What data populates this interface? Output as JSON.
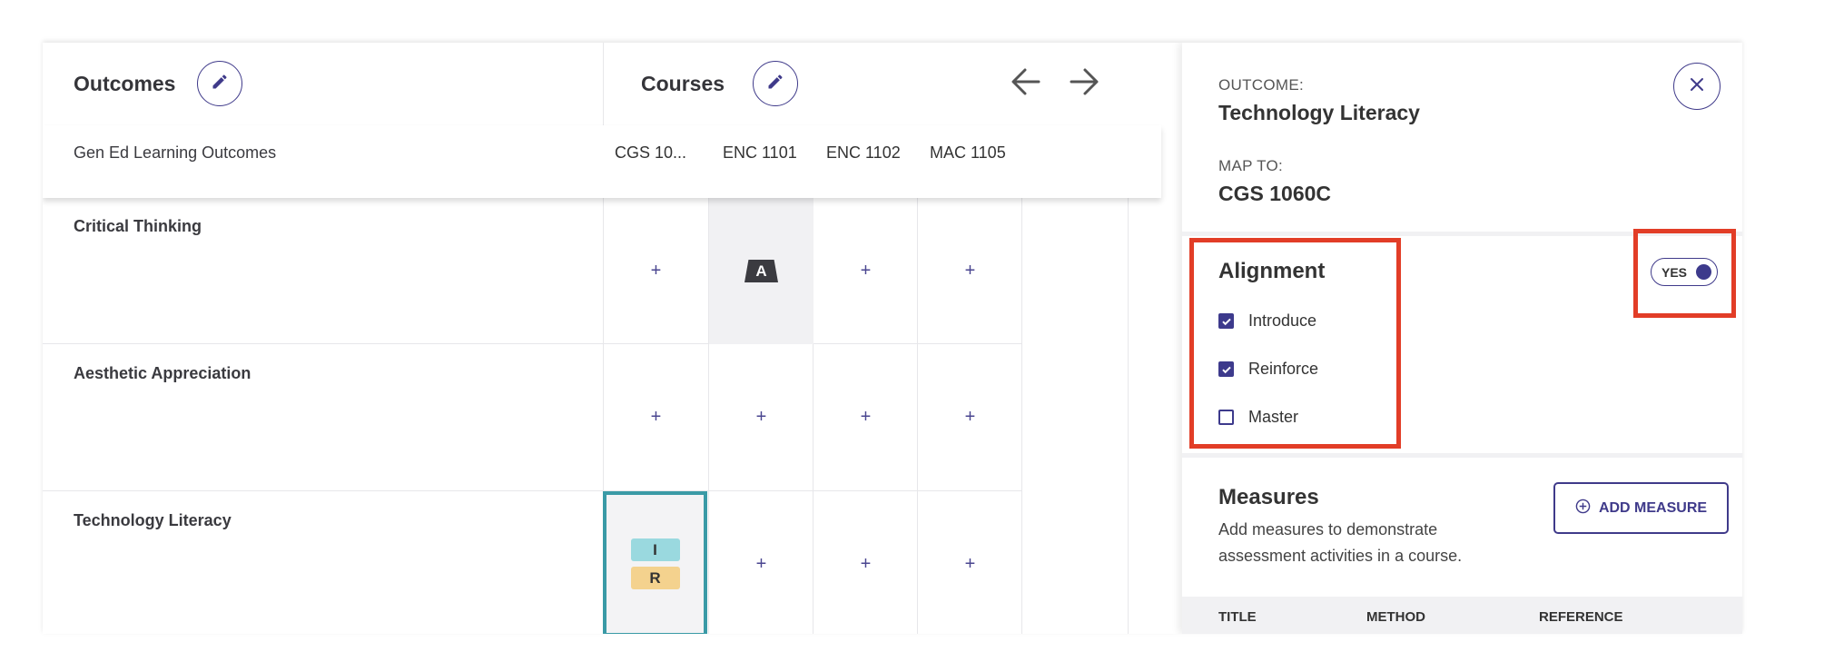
{
  "grid": {
    "outcomes_title": "Outcomes",
    "courses_title": "Courses",
    "sub_header": "Gen Ed Learning Outcomes",
    "courses": [
      "CGS 10...",
      "ENC 1101",
      "ENC 1102",
      "MAC 1105"
    ],
    "rows": [
      {
        "label": "Critical Thinking",
        "cells": [
          "+",
          "A",
          "+",
          "+"
        ]
      },
      {
        "label": "Aesthetic Appreciation",
        "cells": [
          "+",
          "+",
          "+",
          "+"
        ]
      },
      {
        "label": "Technology Literacy",
        "cells": [
          "I/R",
          "+",
          "+",
          "+"
        ]
      }
    ],
    "tag_i": "I",
    "tag_r": "R"
  },
  "panel": {
    "outcome_label": "OUTCOME:",
    "outcome_value": "Technology Literacy",
    "map_label": "MAP TO:",
    "map_value": "CGS 1060C",
    "alignment_title": "Alignment",
    "toggle_label": "YES",
    "checkboxes": [
      {
        "label": "Introduce",
        "checked": true
      },
      {
        "label": "Reinforce",
        "checked": true
      },
      {
        "label": "Master",
        "checked": false
      }
    ],
    "measures_title": "Measures",
    "measures_desc": "Add measures to demonstrate assessment activities in a course.",
    "add_measure": "ADD MEASURE",
    "table_headers": [
      "TITLE",
      "METHOD",
      "REFERENCE"
    ]
  },
  "colors": {
    "accent": "#3f3a8a",
    "selected_border": "#3a9aa6",
    "tag_introduce": "#9ad9df",
    "tag_reinforce": "#f4d28e",
    "highlight": "#e23d27"
  }
}
